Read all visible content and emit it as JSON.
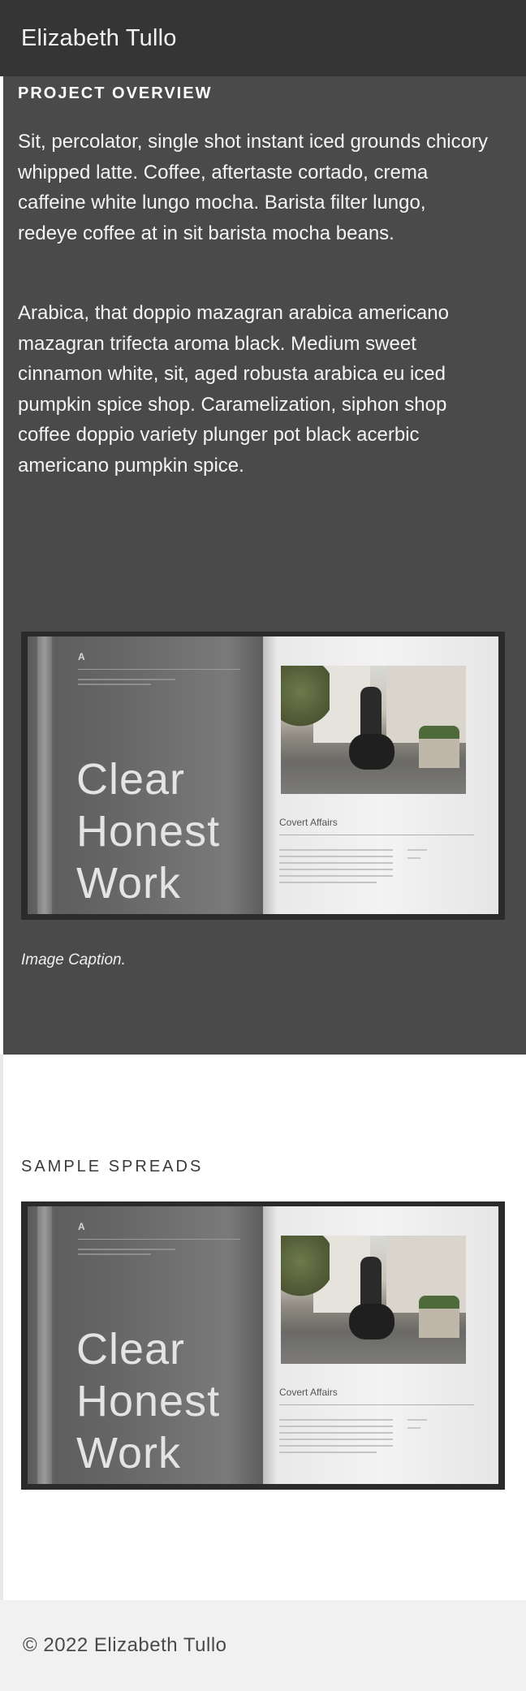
{
  "header": {
    "site_title": "Elizabeth Tullo"
  },
  "overview": {
    "heading": "PROJECT OVERVIEW",
    "paragraphs": [
      "Sit, percolator, single shot instant iced grounds chicory whipped latte. Coffee, aftertaste cortado, crema caffeine white lungo mocha. Barista filter lungo, redeye coffee at in sit barista mocha beans.",
      "Arabica, that doppio mazagran arabica americano mazagran trifecta aroma black. Medium sweet cinnamon white, sit, aged robusta arabica eu iced pumpkin spice shop. Caramelization, siphon shop coffee doppio variety plunger pot black acerbic americano pumpkin spice."
    ],
    "image_caption": "Image Caption."
  },
  "spread": {
    "cover_title_lines": [
      "Clear",
      "Honest",
      "Work"
    ],
    "article_title": "Covert Affairs",
    "logo_glyph": "A"
  },
  "sample_spreads": {
    "heading": "SAMPLE SPREADS"
  },
  "footer": {
    "copyright": "© 2022 Elizabeth Tullo"
  }
}
